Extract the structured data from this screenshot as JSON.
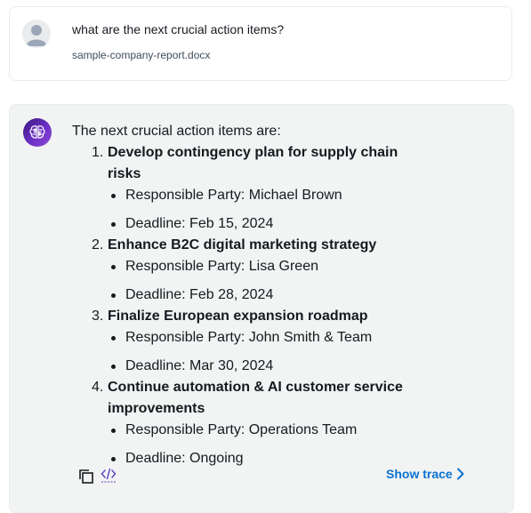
{
  "user_message": {
    "avatar_icon": "user-avatar-icon",
    "question": "what are the next crucial action items?",
    "attachment": "sample-company-report.docx"
  },
  "bot_message": {
    "avatar_icon": "ai-brain-icon",
    "intro": "The next crucial action items are:",
    "items": [
      {
        "number": "1.",
        "title": "Develop contingency plan for supply chain risks",
        "responsible": "Responsible Party: Michael Brown",
        "deadline": "Deadline: Feb 15, 2024"
      },
      {
        "number": "2.",
        "title": "Enhance B2C digital marketing strategy",
        "responsible": "Responsible Party: Lisa Green",
        "deadline": "Deadline: Feb 28, 2024"
      },
      {
        "number": "3.",
        "title": "Finalize European expansion roadmap",
        "responsible": "Responsible Party: John Smith & Team",
        "deadline": "Deadline: Mar 30, 2024"
      },
      {
        "number": "4.",
        "title": "Continue automation & AI customer service improvements",
        "responsible": "Responsible Party: Operations Team",
        "deadline": "Deadline: Ongoing"
      }
    ],
    "footer": {
      "copy_icon": "copy-icon",
      "code_icon": "code-icon",
      "show_trace_label": "Show trace",
      "chevron_icon": "chevron-right-icon"
    }
  },
  "colors": {
    "link": "#0972d3",
    "bot_card_bg": "#f2f3f3",
    "avatar_purple": "#6b2fc4"
  }
}
